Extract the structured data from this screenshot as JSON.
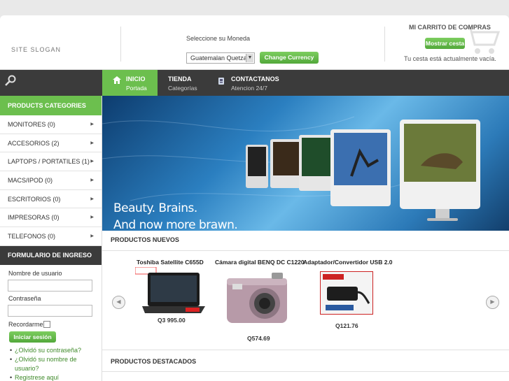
{
  "header": {
    "slogan": "SITE SLOGAN",
    "currency_label": "Seleccione su Moneda",
    "currency_selected": "Guatemalan Quetzal",
    "change_currency_button": "Change Currency",
    "cart_title": "MI CARRITO DE COMPRAS",
    "show_cart_button": "Mostrar cesta",
    "cart_empty_text": "Tu cesta está actualmente vacía."
  },
  "nav": {
    "items": [
      {
        "title": "INICIO",
        "subtitle": "Portada"
      },
      {
        "title": "TIENDA",
        "subtitle": "Categorías"
      },
      {
        "title": "CONTACTANOS",
        "subtitle": "Atencion 24/7"
      }
    ]
  },
  "sidebar": {
    "categories_title": "PRODUCTS CATEGORIES",
    "categories": [
      "MONITORES (0)",
      "ACCESORIOS (2)",
      "LAPTOPS / PORTATILES (1)",
      "MACS/IPOD (0)",
      "ESCRITORIOS (0)",
      "IMPRESORAS (0)",
      "TELEFONOS (0)"
    ],
    "login": {
      "title": "FORMULARIO DE INGRESO",
      "username_label": "Nombre de usuario",
      "password_label": "Contraseña",
      "remember_label": "Recordarme",
      "login_button": "Iniciar sesión",
      "links": [
        "¿Olvidó su contraseña?",
        "¿Olvidó su nombre de usuario?",
        "Registrese aquí"
      ]
    }
  },
  "banner": {
    "line1": "Beauty.  Brains.",
    "line2": "And now more brawn."
  },
  "new_products": {
    "title": "PRODUCTOS NUEVOS",
    "items": [
      {
        "name": "Toshiba Satellite C655D",
        "price": "Q3 995.00"
      },
      {
        "name": "Cámara digital BENQ DC C1220",
        "price": "Q574.69"
      },
      {
        "name": "Adaptador/Convertidor USB 2.0",
        "price": "Q121.76"
      }
    ]
  },
  "featured_products": {
    "title": "PRODUCTOS DESTACADOS"
  },
  "colors": {
    "accent_green": "#6cbf4e",
    "nav_dark": "#3b3b3b"
  }
}
